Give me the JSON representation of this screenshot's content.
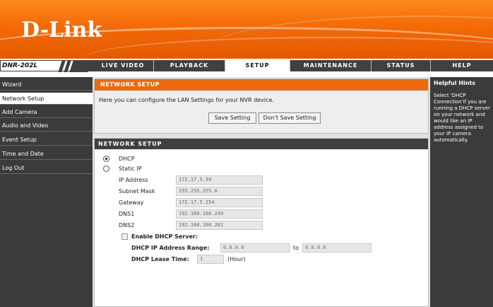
{
  "brand": {
    "logo_text": "D-Link",
    "model": "DNR-202L"
  },
  "colors": {
    "brand_orange": "#f36a07",
    "nav_dark": "#404040",
    "section_header": "#ea6a12"
  },
  "nav": {
    "tabs": [
      "LIVE VIDEO",
      "PLAYBACK",
      "SETUP",
      "MAINTENANCE",
      "STATUS",
      "HELP"
    ],
    "active": "SETUP"
  },
  "sidebar": {
    "items": [
      "Wizard",
      "Network Setup",
      "Add Camera",
      "Audio and Video",
      "Event Setup",
      "Time and Date",
      "Log Out"
    ],
    "active": "Network Setup"
  },
  "intro": {
    "title": "NETWORK SETUP",
    "description": "Here you can configure the LAN Settings for your NVR device.",
    "save_label": "Save Setting",
    "dont_save_label": "Don't Save Setting"
  },
  "network": {
    "title": "NETWORK SETUP",
    "dhcp_label": "DHCP",
    "static_label": "Static IP",
    "selected_mode": "DHCP",
    "fields": [
      {
        "label": "IP Address",
        "value": "172.17.5.39"
      },
      {
        "label": "Subnet Mask",
        "value": "255.255.255.0"
      },
      {
        "label": "Gateway",
        "value": "172.17.5.254"
      },
      {
        "label": "DNS1",
        "value": "192.168.168.249"
      },
      {
        "label": "DNS2",
        "value": "192.168.168.201"
      }
    ],
    "dhcp_server": {
      "enable_label": "Enable DHCP Server:",
      "enabled": false,
      "range_label": "DHCP IP Address Range:",
      "range_from": "0.0.0.0",
      "to_label": "to",
      "range_to": "0.0.0.0",
      "lease_label": "DHCP Lease Time:",
      "lease_value": "1",
      "lease_unit": "(Hour)"
    }
  },
  "hints": {
    "title": "Helpful Hints",
    "lines": [
      "Select 'DHCP",
      "Connection'if you are",
      "running a DHCP server",
      "on your network and",
      "would like an IP",
      "address assigned to",
      "your IP camera",
      "automatically."
    ]
  }
}
